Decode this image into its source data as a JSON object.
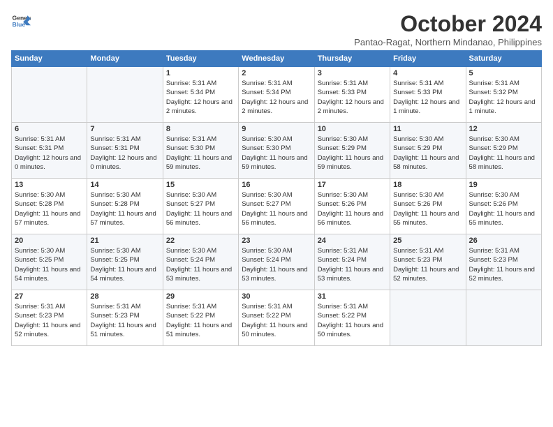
{
  "logo": {
    "line1": "General",
    "line2": "Blue"
  },
  "title": "October 2024",
  "subtitle": "Pantao-Ragat, Northern Mindanao, Philippines",
  "days_of_week": [
    "Sunday",
    "Monday",
    "Tuesday",
    "Wednesday",
    "Thursday",
    "Friday",
    "Saturday"
  ],
  "weeks": [
    [
      {
        "day": "",
        "sunrise": "",
        "sunset": "",
        "daylight": ""
      },
      {
        "day": "",
        "sunrise": "",
        "sunset": "",
        "daylight": ""
      },
      {
        "day": "1",
        "sunrise": "Sunrise: 5:31 AM",
        "sunset": "Sunset: 5:34 PM",
        "daylight": "Daylight: 12 hours and 2 minutes."
      },
      {
        "day": "2",
        "sunrise": "Sunrise: 5:31 AM",
        "sunset": "Sunset: 5:34 PM",
        "daylight": "Daylight: 12 hours and 2 minutes."
      },
      {
        "day": "3",
        "sunrise": "Sunrise: 5:31 AM",
        "sunset": "Sunset: 5:33 PM",
        "daylight": "Daylight: 12 hours and 2 minutes."
      },
      {
        "day": "4",
        "sunrise": "Sunrise: 5:31 AM",
        "sunset": "Sunset: 5:33 PM",
        "daylight": "Daylight: 12 hours and 1 minute."
      },
      {
        "day": "5",
        "sunrise": "Sunrise: 5:31 AM",
        "sunset": "Sunset: 5:32 PM",
        "daylight": "Daylight: 12 hours and 1 minute."
      }
    ],
    [
      {
        "day": "6",
        "sunrise": "Sunrise: 5:31 AM",
        "sunset": "Sunset: 5:31 PM",
        "daylight": "Daylight: 12 hours and 0 minutes."
      },
      {
        "day": "7",
        "sunrise": "Sunrise: 5:31 AM",
        "sunset": "Sunset: 5:31 PM",
        "daylight": "Daylight: 12 hours and 0 minutes."
      },
      {
        "day": "8",
        "sunrise": "Sunrise: 5:31 AM",
        "sunset": "Sunset: 5:30 PM",
        "daylight": "Daylight: 11 hours and 59 minutes."
      },
      {
        "day": "9",
        "sunrise": "Sunrise: 5:30 AM",
        "sunset": "Sunset: 5:30 PM",
        "daylight": "Daylight: 11 hours and 59 minutes."
      },
      {
        "day": "10",
        "sunrise": "Sunrise: 5:30 AM",
        "sunset": "Sunset: 5:29 PM",
        "daylight": "Daylight: 11 hours and 59 minutes."
      },
      {
        "day": "11",
        "sunrise": "Sunrise: 5:30 AM",
        "sunset": "Sunset: 5:29 PM",
        "daylight": "Daylight: 11 hours and 58 minutes."
      },
      {
        "day": "12",
        "sunrise": "Sunrise: 5:30 AM",
        "sunset": "Sunset: 5:29 PM",
        "daylight": "Daylight: 11 hours and 58 minutes."
      }
    ],
    [
      {
        "day": "13",
        "sunrise": "Sunrise: 5:30 AM",
        "sunset": "Sunset: 5:28 PM",
        "daylight": "Daylight: 11 hours and 57 minutes."
      },
      {
        "day": "14",
        "sunrise": "Sunrise: 5:30 AM",
        "sunset": "Sunset: 5:28 PM",
        "daylight": "Daylight: 11 hours and 57 minutes."
      },
      {
        "day": "15",
        "sunrise": "Sunrise: 5:30 AM",
        "sunset": "Sunset: 5:27 PM",
        "daylight": "Daylight: 11 hours and 56 minutes."
      },
      {
        "day": "16",
        "sunrise": "Sunrise: 5:30 AM",
        "sunset": "Sunset: 5:27 PM",
        "daylight": "Daylight: 11 hours and 56 minutes."
      },
      {
        "day": "17",
        "sunrise": "Sunrise: 5:30 AM",
        "sunset": "Sunset: 5:26 PM",
        "daylight": "Daylight: 11 hours and 56 minutes."
      },
      {
        "day": "18",
        "sunrise": "Sunrise: 5:30 AM",
        "sunset": "Sunset: 5:26 PM",
        "daylight": "Daylight: 11 hours and 55 minutes."
      },
      {
        "day": "19",
        "sunrise": "Sunrise: 5:30 AM",
        "sunset": "Sunset: 5:26 PM",
        "daylight": "Daylight: 11 hours and 55 minutes."
      }
    ],
    [
      {
        "day": "20",
        "sunrise": "Sunrise: 5:30 AM",
        "sunset": "Sunset: 5:25 PM",
        "daylight": "Daylight: 11 hours and 54 minutes."
      },
      {
        "day": "21",
        "sunrise": "Sunrise: 5:30 AM",
        "sunset": "Sunset: 5:25 PM",
        "daylight": "Daylight: 11 hours and 54 minutes."
      },
      {
        "day": "22",
        "sunrise": "Sunrise: 5:30 AM",
        "sunset": "Sunset: 5:24 PM",
        "daylight": "Daylight: 11 hours and 53 minutes."
      },
      {
        "day": "23",
        "sunrise": "Sunrise: 5:30 AM",
        "sunset": "Sunset: 5:24 PM",
        "daylight": "Daylight: 11 hours and 53 minutes."
      },
      {
        "day": "24",
        "sunrise": "Sunrise: 5:31 AM",
        "sunset": "Sunset: 5:24 PM",
        "daylight": "Daylight: 11 hours and 53 minutes."
      },
      {
        "day": "25",
        "sunrise": "Sunrise: 5:31 AM",
        "sunset": "Sunset: 5:23 PM",
        "daylight": "Daylight: 11 hours and 52 minutes."
      },
      {
        "day": "26",
        "sunrise": "Sunrise: 5:31 AM",
        "sunset": "Sunset: 5:23 PM",
        "daylight": "Daylight: 11 hours and 52 minutes."
      }
    ],
    [
      {
        "day": "27",
        "sunrise": "Sunrise: 5:31 AM",
        "sunset": "Sunset: 5:23 PM",
        "daylight": "Daylight: 11 hours and 52 minutes."
      },
      {
        "day": "28",
        "sunrise": "Sunrise: 5:31 AM",
        "sunset": "Sunset: 5:23 PM",
        "daylight": "Daylight: 11 hours and 51 minutes."
      },
      {
        "day": "29",
        "sunrise": "Sunrise: 5:31 AM",
        "sunset": "Sunset: 5:22 PM",
        "daylight": "Daylight: 11 hours and 51 minutes."
      },
      {
        "day": "30",
        "sunrise": "Sunrise: 5:31 AM",
        "sunset": "Sunset: 5:22 PM",
        "daylight": "Daylight: 11 hours and 50 minutes."
      },
      {
        "day": "31",
        "sunrise": "Sunrise: 5:31 AM",
        "sunset": "Sunset: 5:22 PM",
        "daylight": "Daylight: 11 hours and 50 minutes."
      },
      {
        "day": "",
        "sunrise": "",
        "sunset": "",
        "daylight": ""
      },
      {
        "day": "",
        "sunrise": "",
        "sunset": "",
        "daylight": ""
      }
    ]
  ]
}
